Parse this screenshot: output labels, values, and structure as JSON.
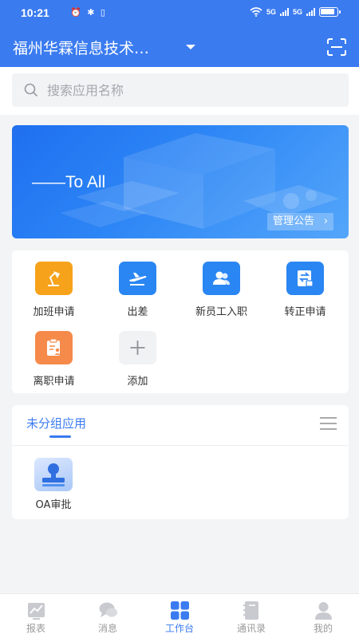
{
  "status_bar": {
    "time": "10:21",
    "left_icons": "⏰ ✱ ▯",
    "network_label": "5G",
    "network_label_2": "5G"
  },
  "header": {
    "company": "福州华霖信息技术…",
    "scan_icon": "scan-icon"
  },
  "search": {
    "placeholder": "搜索应用名称"
  },
  "banner": {
    "slogan": "——To All",
    "notice_button": "管理公告",
    "notice_chevron": "›"
  },
  "quick_apps": [
    {
      "label": "加班申请",
      "icon": "desk-lamp-icon",
      "color": "#f7a21b"
    },
    {
      "label": "出差",
      "icon": "airplane-icon",
      "color": "#2a86f2"
    },
    {
      "label": "新员工入职",
      "icon": "users-icon",
      "color": "#2a86f2"
    },
    {
      "label": "转正申请",
      "icon": "transfer-document-icon",
      "color": "#2a86f2"
    },
    {
      "label": "离职申请",
      "icon": "clipboard-person-icon",
      "color": "#f58a4b"
    },
    {
      "label": "添加",
      "icon": "plus-icon",
      "color": "#f1f2f4"
    }
  ],
  "group": {
    "tab_label": "未分组应用",
    "apps": [
      {
        "label": "OA审批",
        "icon": "stamp-icon"
      }
    ]
  },
  "bottom_nav": [
    {
      "label": "报表",
      "icon": "chart-icon",
      "active": false
    },
    {
      "label": "消息",
      "icon": "chat-bubble-icon",
      "active": false
    },
    {
      "label": "工作台",
      "icon": "grid-icon",
      "active": true
    },
    {
      "label": "通讯录",
      "icon": "contacts-book-icon",
      "active": false
    },
    {
      "label": "我的",
      "icon": "person-icon",
      "active": false
    }
  ],
  "colors": {
    "primary": "#3a7bf0",
    "orange": "#f7a21b",
    "inactive": "#999999"
  }
}
